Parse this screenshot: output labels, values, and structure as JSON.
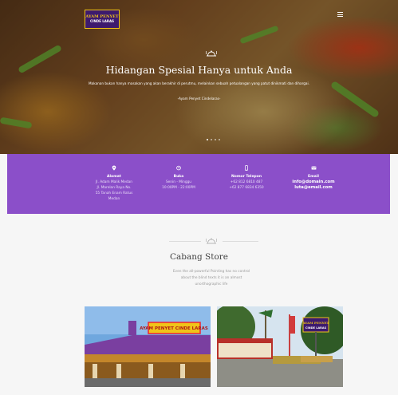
{
  "header": {
    "logo_line1": "AYAM PENYET",
    "logo_line2": "CINDE LARAS"
  },
  "hero": {
    "title": "Hidangan Spesial Hanya untuk Anda",
    "subtitle": "Makanan bukan hanya masakan yang akan berakhir di perutmu, melainkan sebuah petualangan yang patut dinikmati dan dihargai.",
    "quote": "-Ayam Penyet Cindelaras-"
  },
  "info": {
    "alamat": {
      "icon": "map-pin-icon",
      "heading": "Alamat",
      "lines": [
        "Jl. Adam Malik Medan",
        "Jl. Marelan Raya No.",
        "55 Tanah Enam Ratus",
        "Medan"
      ]
    },
    "buka": {
      "icon": "clock-icon",
      "heading": "Buka",
      "lines": [
        "Senin - Minggu",
        "10:00PM - 22:00PM"
      ]
    },
    "telepon": {
      "icon": "phone-icon",
      "heading": "Nomor Telepon",
      "lines": [
        "+62 812 6810 487",
        "+62 877 6834 6350"
      ]
    },
    "email": {
      "icon": "mail-icon",
      "heading": "Email",
      "lines": [
        "info@domain.com",
        "luta@email.com"
      ]
    }
  },
  "cabang": {
    "title": "Cabang Store",
    "text_lines": [
      "Even the all-powerful Pointing has no control",
      "about the blind texts it is an almost",
      "unorthographic life"
    ],
    "store1_sign": "AYAM PENYET CINDE LARAS",
    "store2_sign_line1": "AYAM PENYET",
    "store2_sign_line2": "CINDE LARAS"
  },
  "colors": {
    "accent": "#8b4fc9",
    "gold": "#f0c419"
  }
}
